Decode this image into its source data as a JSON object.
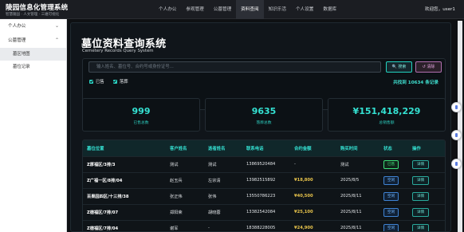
{
  "brand": {
    "title": "陵园信息化管理系统",
    "subtitle": "智慧陵园 · 人文管理 · 三維可视化"
  },
  "topnav": [
    {
      "label": "个人办公",
      "active": false
    },
    {
      "label": "参观管理",
      "active": false
    },
    {
      "label": "公墓管理",
      "active": false
    },
    {
      "label": "资料查阅",
      "active": true
    },
    {
      "label": "知识乐活",
      "active": false
    },
    {
      "label": "个人设置",
      "active": false
    },
    {
      "label": "数据库",
      "active": false
    }
  ],
  "user": {
    "greeting": "欢迎您，user1"
  },
  "sidebar": {
    "groups": [
      {
        "label": "个人办公",
        "chevron": "⌄",
        "items": []
      },
      {
        "label": "公墓管理",
        "chevron": "⌃",
        "items": [
          {
            "label": "墓区地图",
            "active": true
          },
          {
            "label": "墓位记录",
            "active": false
          }
        ]
      }
    ]
  },
  "page": {
    "title": "墓位资料查询系统",
    "subtitle": "Cemetery Records Query System"
  },
  "search": {
    "placeholder": "输入姓名、墓位号、合约号或身份证号...",
    "search_label": "🔍 搜索",
    "clear_label": "↺ 清除",
    "filters": [
      {
        "label": "已售",
        "checked": true
      },
      {
        "label": "落葬",
        "checked": true
      }
    ],
    "found_text": "共找到 10634 条记录"
  },
  "stats": [
    {
      "value": "999",
      "label": "已售总数"
    },
    {
      "value": "9635",
      "label": "落葬总数"
    },
    {
      "value": "¥151,418,229",
      "label": "总销售额"
    }
  ],
  "table": {
    "columns": [
      "墓位位置",
      "客户姓名",
      "逝者姓名",
      "联系电话",
      "合约金额",
      "购买时间",
      "状态",
      "操作"
    ],
    "action_label": "详情",
    "rows": [
      {
        "location": "Z厚福区/3排/3",
        "customer": "测试",
        "deceased": "测试",
        "phone": "13869520484",
        "amount": "-",
        "date": "测试",
        "status": "已售",
        "status_type": "sold"
      },
      {
        "location": "Z广福一区/8排/04",
        "customer": "赵玉兵",
        "deceased": "左宗清",
        "phone": "13982515892",
        "amount": "¥18,800",
        "date": "2025/8/5",
        "status": "空闲",
        "status_type": "avail"
      },
      {
        "location": "百果园四区/十三排/38",
        "customer": "张正伟",
        "deceased": "张伟",
        "phone": "13550786223",
        "amount": "¥40,500",
        "date": "2025/8/11",
        "status": "空闲",
        "status_type": "avail"
      },
      {
        "location": "Z德福区/7排/07",
        "customer": "郑阳荣",
        "deceased": "胡晓蓉",
        "phone": "13382542084",
        "amount": "¥25,100",
        "date": "2025/8/11",
        "status": "空闲",
        "status_type": "avail"
      },
      {
        "location": "Z德福区/7排/04",
        "customer": "谢军",
        "deceased": "-",
        "phone": "18388228005",
        "amount": "¥24,900",
        "date": "2025/8/11",
        "status": "空闲",
        "status_type": "avail"
      }
    ]
  },
  "colors": {
    "accent": "#34e1d2",
    "money": "#e7c34b",
    "sold": "#3ee07a",
    "avail": "#6fb6ff"
  }
}
